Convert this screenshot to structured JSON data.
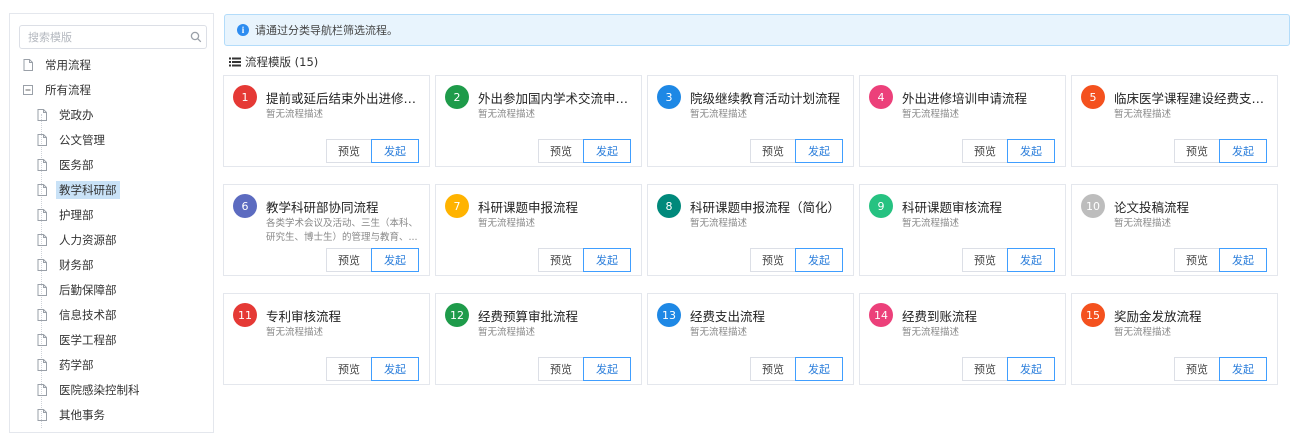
{
  "sidebar": {
    "search_placeholder": "搜索模版",
    "tree": [
      {
        "label": "常用流程",
        "icon": "file-icon",
        "level": 0
      },
      {
        "label": "所有流程",
        "icon": "collapse-icon",
        "level": 0
      },
      {
        "label": "党政办",
        "icon": "file-icon",
        "level": 1
      },
      {
        "label": "公文管理",
        "icon": "file-icon",
        "level": 1
      },
      {
        "label": "医务部",
        "icon": "file-icon",
        "level": 1
      },
      {
        "label": "教学科研部",
        "icon": "file-icon",
        "level": 1,
        "selected": true
      },
      {
        "label": "护理部",
        "icon": "file-icon",
        "level": 1
      },
      {
        "label": "人力资源部",
        "icon": "file-icon",
        "level": 1
      },
      {
        "label": "财务部",
        "icon": "file-icon",
        "level": 1
      },
      {
        "label": "后勤保障部",
        "icon": "file-icon",
        "level": 1
      },
      {
        "label": "信息技术部",
        "icon": "file-icon",
        "level": 1
      },
      {
        "label": "医学工程部",
        "icon": "file-icon",
        "level": 1
      },
      {
        "label": "药学部",
        "icon": "file-icon",
        "level": 1
      },
      {
        "label": "医院感染控制科",
        "icon": "file-icon",
        "level": 1
      },
      {
        "label": "其他事务",
        "icon": "file-icon",
        "level": 1
      }
    ]
  },
  "notice": {
    "text": "请通过分类导航栏筛选流程。",
    "icon": "info-icon"
  },
  "section": {
    "title": "流程模版 (15)",
    "icon": "list-icon"
  },
  "buttons": {
    "preview": "预览",
    "launch": "发起"
  },
  "colors": {
    "accent": "#409eff",
    "selected_bg": "#c9e2f7",
    "info_bg": "#e8f4fd"
  },
  "cards": [
    {
      "num": "1",
      "title": "提前或延后结束外出进修培训...",
      "desc": "暂无流程描述",
      "color": "#e53935"
    },
    {
      "num": "2",
      "title": "外出参加国内学术交流申请...",
      "desc": "暂无流程描述",
      "color": "#1e9b4a"
    },
    {
      "num": "3",
      "title": "院级继续教育活动计划流程",
      "desc": "暂无流程描述",
      "color": "#1e88e5"
    },
    {
      "num": "4",
      "title": "外出进修培训申请流程",
      "desc": "暂无流程描述",
      "color": "#ec407a"
    },
    {
      "num": "5",
      "title": "临床医学课程建设经费支出...",
      "desc": "暂无流程描述",
      "color": "#f4511e"
    },
    {
      "num": "6",
      "title": "教学科研部协同流程",
      "desc": "各类学术会议及活动、三生（本科、研究生、博士生）的管理与教育、...",
      "color": "#5c6bc0"
    },
    {
      "num": "7",
      "title": "科研课题申报流程",
      "desc": "暂无流程描述",
      "color": "#ffb300"
    },
    {
      "num": "8",
      "title": "科研课题申报流程（简化）",
      "desc": "暂无流程描述",
      "color": "#00897b"
    },
    {
      "num": "9",
      "title": "科研课题审核流程",
      "desc": "暂无流程描述",
      "color": "#26c281"
    },
    {
      "num": "10",
      "title": "论文投稿流程",
      "desc": "暂无流程描述",
      "color": "#bdbdbd"
    },
    {
      "num": "11",
      "title": "专利审核流程",
      "desc": "暂无流程描述",
      "color": "#e53935"
    },
    {
      "num": "12",
      "title": "经费预算审批流程",
      "desc": "暂无流程描述",
      "color": "#1e9b4a"
    },
    {
      "num": "13",
      "title": "经费支出流程",
      "desc": "暂无流程描述",
      "color": "#1e88e5"
    },
    {
      "num": "14",
      "title": "经费到账流程",
      "desc": "暂无流程描述",
      "color": "#ec407a"
    },
    {
      "num": "15",
      "title": "奖励金发放流程",
      "desc": "暂无流程描述",
      "color": "#f4511e"
    }
  ]
}
